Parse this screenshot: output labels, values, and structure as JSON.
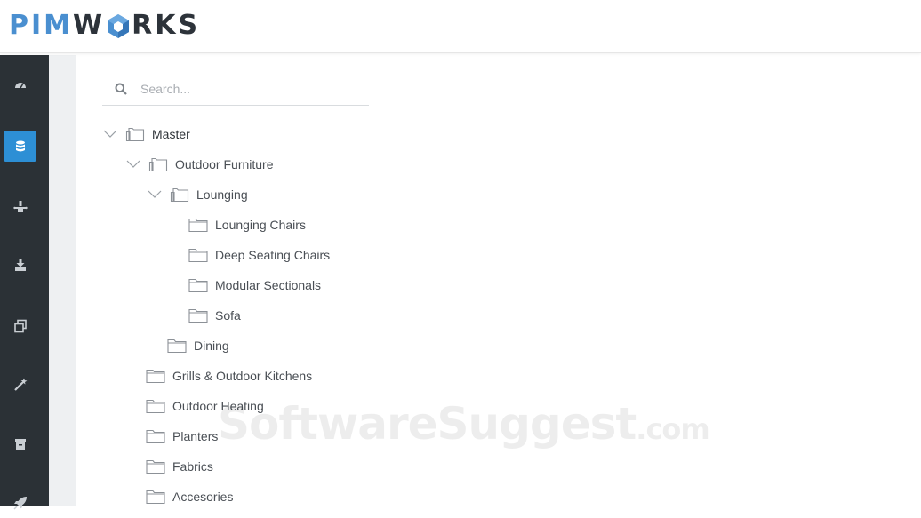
{
  "brand": {
    "part1": "PIM",
    "part2": "RKS",
    "pre_cube": "W",
    "accent": "#4a8fd0",
    "dark": "#2d333a"
  },
  "sidebar": {
    "items": [
      {
        "icon": "dashboard-icon",
        "active": false
      },
      {
        "icon": "database-icon",
        "active": true
      },
      {
        "icon": "hierarchy-icon",
        "active": false
      },
      {
        "icon": "download-icon",
        "active": false
      },
      {
        "icon": "copy-icon",
        "active": false
      },
      {
        "icon": "magic-wand-icon",
        "active": false
      },
      {
        "icon": "archive-icon",
        "active": false
      },
      {
        "icon": "rocket-icon",
        "active": false
      }
    ],
    "active_color": "#2d8fd5",
    "bg_color": "#2b3136"
  },
  "search": {
    "placeholder": "Search..."
  },
  "tree": {
    "master": "Master",
    "outdoor_furniture": "Outdoor Furniture",
    "lounging": "Lounging",
    "lounging_chairs": "Lounging Chairs",
    "deep_seating_chairs": "Deep Seating Chairs",
    "modular_sectionals": "Modular Sectionals",
    "sofa": "Sofa",
    "dining": "Dining",
    "grills": "Grills & Outdoor Kitchens",
    "outdoor_heating": "Outdoor Heating",
    "planters": "Planters",
    "fabrics": "Fabrics",
    "accesories": "Accesories"
  },
  "watermark": {
    "main": "SoftwareSuggest",
    "suffix": ".com"
  }
}
